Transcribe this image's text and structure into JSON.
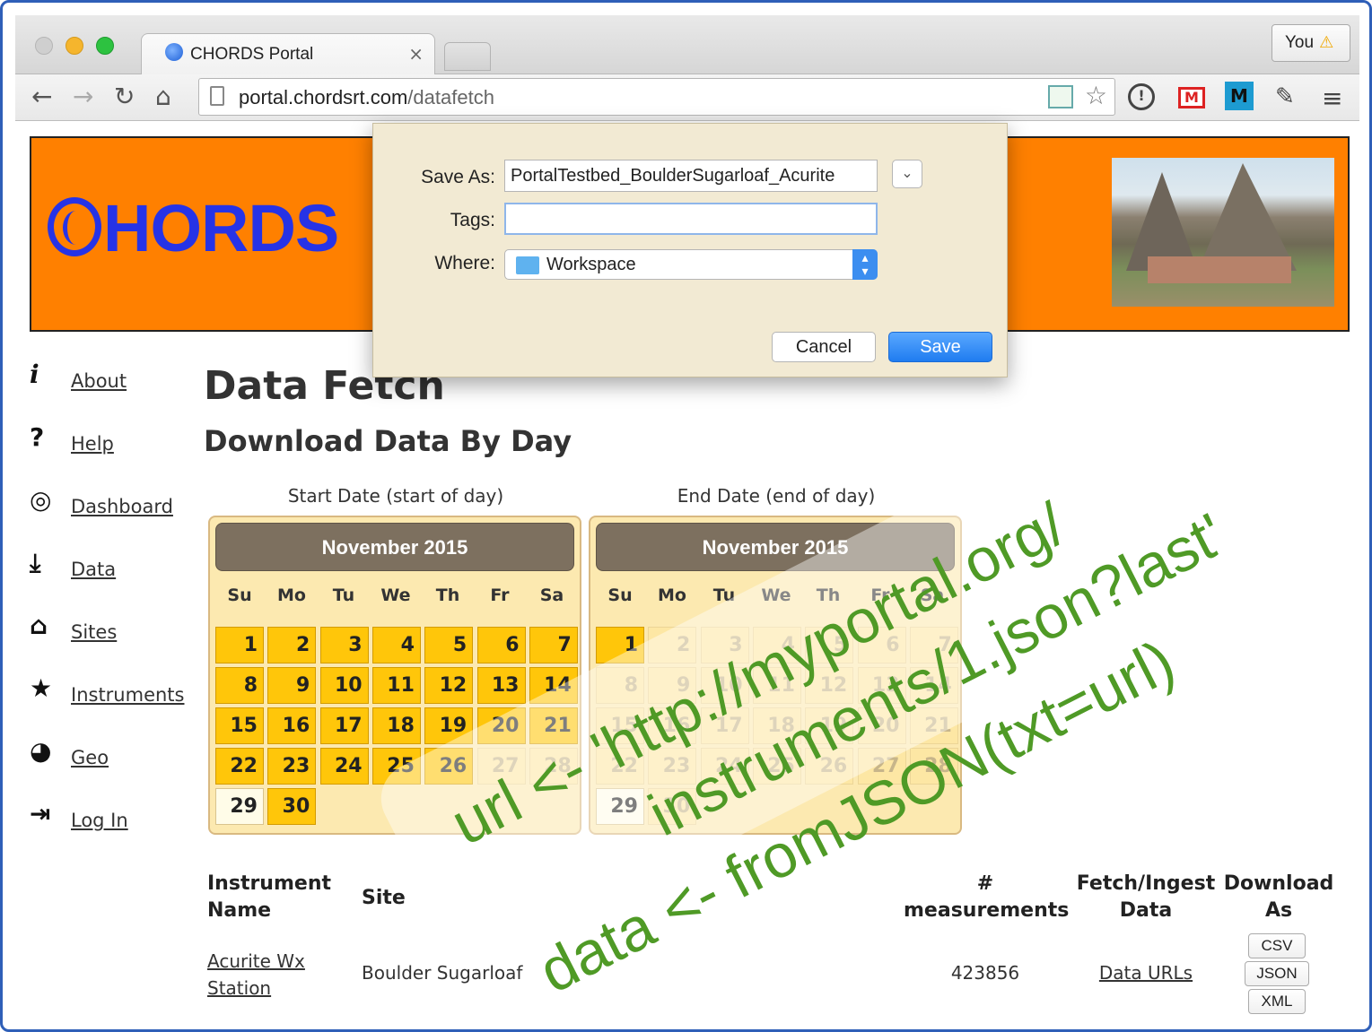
{
  "browser": {
    "tab_title": "CHORDS Portal",
    "tab_close": "×",
    "user_label": "You",
    "user_warning": "⚠",
    "url_host": "portal.chordsrt.com",
    "url_path": "/datafetch"
  },
  "banner": {
    "logo_text": "HORDS"
  },
  "sidebar": {
    "items": [
      {
        "icon": "i",
        "label": "About"
      },
      {
        "icon": "?",
        "label": "Help"
      },
      {
        "icon": "◎",
        "label": "Dashboard"
      },
      {
        "icon": "⤓",
        "label": "Data"
      },
      {
        "icon": "⌂",
        "label": "Sites"
      },
      {
        "icon": "★",
        "label": "Instruments"
      },
      {
        "icon": "◕",
        "label": "Geo"
      },
      {
        "icon": "⇥",
        "label": "Log In"
      }
    ]
  },
  "main": {
    "title": "Data Fetch",
    "subtitle": "Download Data By Day",
    "start_label": "Start Date (start of day)",
    "end_label": "End Date (end of day)",
    "calendars": [
      {
        "month": "November 2015"
      },
      {
        "month": "November 2015"
      }
    ],
    "weekdays": [
      "Su",
      "Mo",
      "Tu",
      "We",
      "Th",
      "Fr",
      "Sa"
    ],
    "table": {
      "headers": {
        "name_1": "Instrument",
        "name_2": "Name",
        "site": "Site",
        "meas_1": "#",
        "meas_2": "measurements",
        "fetch_1": "Fetch/Ingest",
        "fetch_2": "Data",
        "dl_1": "Download",
        "dl_2": "As"
      },
      "row": {
        "name_1": "Acurite Wx",
        "name_2": "Station",
        "site": "Boulder Sugarloaf",
        "measurements": "423856",
        "fetch_link": "Data URLs",
        "formats": [
          "CSV",
          "JSON",
          "XML"
        ]
      }
    }
  },
  "dialog": {
    "save_as_label": "Save As:",
    "save_as_value": "PortalTestbed_BoulderSugarloaf_Acurite",
    "tags_label": "Tags:",
    "tags_value": "",
    "where_label": "Where:",
    "where_value": "Workspace",
    "cancel_label": "Cancel",
    "save_label": "Save"
  },
  "overlay": {
    "line1": "url <- 'http://myportal.org/",
    "line2": "instruments/1.json?last'",
    "line3": "data <- fromJSON(txt=url)"
  },
  "colors": {
    "banner": "#ff8000",
    "logo": "#2633e6",
    "day_selected": "#ffc60a",
    "overlay_text": "#4f9a26",
    "save_button": "#1f7cf0"
  }
}
